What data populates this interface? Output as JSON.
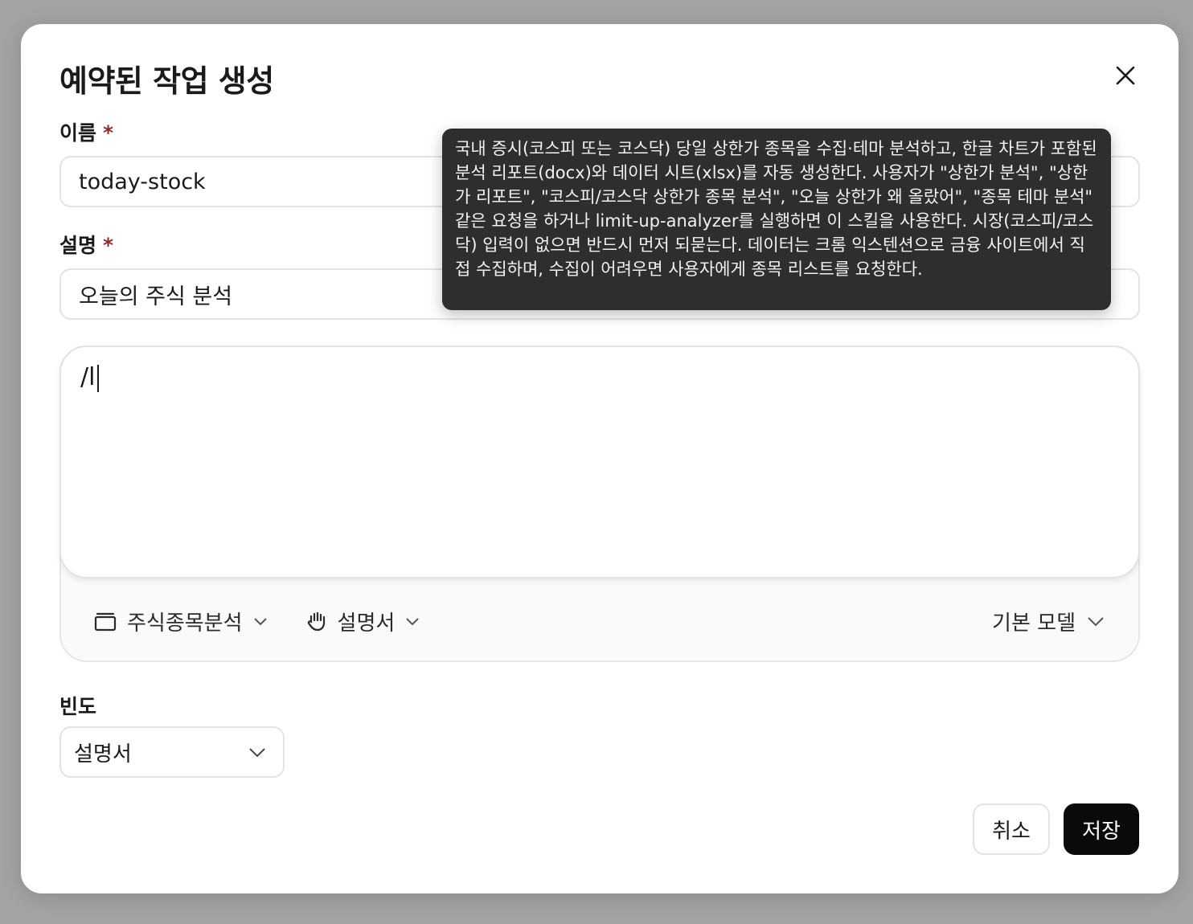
{
  "dialog": {
    "title": "예약된 작업 생성"
  },
  "name_field": {
    "label": "이름",
    "required_mark": "*",
    "value": "today-stock"
  },
  "description_field": {
    "label": "설명",
    "required_mark": "*",
    "value": "오늘의 주식 분석"
  },
  "prompt": {
    "value": "/l"
  },
  "toolbar": {
    "project_label": "주식종목분석",
    "skill_label": "설명서",
    "model_label": "기본 모델"
  },
  "frequency_field": {
    "label": "빈도",
    "selected": "설명서"
  },
  "actions": {
    "cancel_label": "취소",
    "save_label": "저장"
  },
  "tooltip": {
    "text": "국내 증시(코스피 또는 코스닥) 당일 상한가 종목을 수집·테마 분석하고, 한글 차트가 포함된 분석 리포트(docx)와 데이터 시트(xlsx)를 자동 생성한다. 사용자가 \"상한가 분석\", \"상한가 리포트\", \"코스피/코스닥 상한가 종목 분석\", \"오늘 상한가 왜 올랐어\", \"종목 테마 분석\" 같은 요청을 하거나 limit-up-analyzer를 실행하면 이 스킬을 사용한다. 시장(코스피/코스닥) 입력이 없으면 반드시 먼저 되묻는다. 데이터는 크롬 익스텐션으로 금융 사이트에서 직접 수집하며, 수집이 어려우면 사용자에게 종목 리스트를 요청한다."
  },
  "colors": {
    "primary_button": "#0a0a0a",
    "required_mark": "#8b2b2b",
    "tooltip_bg": "#2e2e2e"
  },
  "icons": {
    "close": "close-icon",
    "project": "folder-icon",
    "skill": "hand-icon",
    "chevron": "chevron-down-icon"
  }
}
